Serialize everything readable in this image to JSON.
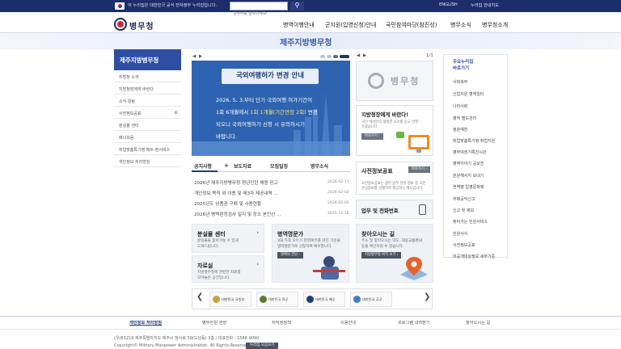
{
  "topbar": {
    "notice": "이 누리집은 대한민국 공식 전자정부 누리집입니다.",
    "search_placeholder": "검색어를 입력하세요!",
    "links": [
      "ENGLISH",
      "누리집 안내지도"
    ]
  },
  "header": {
    "logo": "병무청",
    "gnb": [
      "병역이행안내",
      "군지원(입영신청)안내",
      "국민참여마당(참진성)",
      "병무소식",
      "병무청소개"
    ]
  },
  "band_title": "제주지방병무청",
  "lnb": {
    "title": "제주지방병무청",
    "items": [
      "지방청 소개",
      "지방청장에게 바란다",
      "소식·알림",
      "사전정보공표",
      "분실물 센터",
      "배너모음",
      "취업맞춤특기병 매트-컴서비스",
      "개인정보 처리방침"
    ],
    "expand_marker": "⊕"
  },
  "slider": {
    "prev": "◀",
    "next": "▶",
    "page": "1/1"
  },
  "banner": {
    "title": "국외여행허가 변경 안내",
    "line1": "2026. 5. 3.부터 단기 국외여행 허가기간이",
    "line2_a": "1회 6개월에서 ",
    "line2_b": "1회 1개월(기간연장 2회)",
    "line2_c": " 변경",
    "line3": "되오니 국외여행허가 신청 시 유의하시기",
    "line4": "바랍니다."
  },
  "tabs": [
    "공지사항",
    "보도자료",
    "모집일정",
    "병무소식"
  ],
  "tab_more": "+",
  "news": [
    {
      "title": "2026년 제주지방병무청 청년인턴 채용 공고",
      "date": "2026-02-11"
    },
    {
      "title": "개인정보 목적 외 이용 및 제3자 제공내역 ...",
      "date": "2026-02-02"
    },
    {
      "title": "2025년도 상품권 구매 및 사용현황",
      "date": "2026-02-02"
    },
    {
      "title": "2026년 병역판정검사 일지 및 장소 본인선 ...",
      "date": "2025-12-16"
    }
  ],
  "quick_boxes": {
    "lost": {
      "title": "분실물 센터",
      "desc1": "분실물을 찾아가실 수 있게",
      "desc2": "도와드립니다.",
      "arrow": "›"
    },
    "data": {
      "title": "자료실",
      "desc1": "지방병무청에 관련한 자료를",
      "desc2": "모아놓은 공간입니다.",
      "arrow": "›"
    },
    "honor": {
      "title": "병역명문가",
      "desc1": "3대 가족 모두가 현역복무를 마친 가문을",
      "desc2": "병역명문가로 선정하여 예우합니다.",
      "btn": "명예의 전당 ›"
    },
    "visit": {
      "title": "찾아오시는 길",
      "desc1": "주소 및 찾아오시는 약도, 대중교통편내",
      "desc2": "등을 확인하실 수 있습니다.",
      "btn": "지방병무청 위치 보기 ›"
    }
  },
  "right": {
    "logo": "병무청",
    "petition": {
      "title": "지방청장에게 바란다!",
      "desc1": "국민 여러분의 생생한 소리를 듣고 반영",
      "desc2": "하겠습니다.",
      "btn": "바로가기 ›"
    },
    "disclosure": {
      "title": "사전정보공표",
      "btn": "바로가기 ›",
      "desc1": "사전정보공표는 정부 업무 관련 정보 중 국민",
      "desc2": "관심정보를 선별하여 제공하는 제도입니다."
    },
    "phone": {
      "title": "업무 및 전화번호"
    }
  },
  "quick_menu": {
    "title1": "주요누리집",
    "title2": "바로가기",
    "items": [
      "사회복무",
      "산업지원 병역일터",
      "나라사랑",
      "병적 별도관리",
      "청춘예찬",
      "취업맞춤특기병 취업지원",
      "병무여권기록진시관",
      "병역이야기 공모전",
      "원원해서지 보내기",
      "현역병 입영문화제",
      "부패공익신고",
      "신고 및 제보",
      "찾아가는 민원서비스",
      "민원서식",
      "사전정보공표",
      "미공개대상정보 세부기준"
    ]
  },
  "partners": {
    "prev": "❮",
    "next": "❯",
    "logos": [
      "대한민국 국방부",
      "대한민국 육군",
      "대한민국 해군",
      "대한민국 공군"
    ]
  },
  "footer": {
    "links": [
      "개인정보 처리방침",
      "병무민원 현장",
      "저작권정책",
      "이용안내",
      "프로그램 내려받기",
      "찾아오시는 길"
    ],
    "address": "(우)63219 제주특별자치도 제주시 청사로 59(도남동) 3층 / 대표전화 : 1588-9090",
    "copyright": "Copyright© Military Manpower Administration. All Rights Reserved.",
    "family_btn": "누리집 모음보기"
  }
}
